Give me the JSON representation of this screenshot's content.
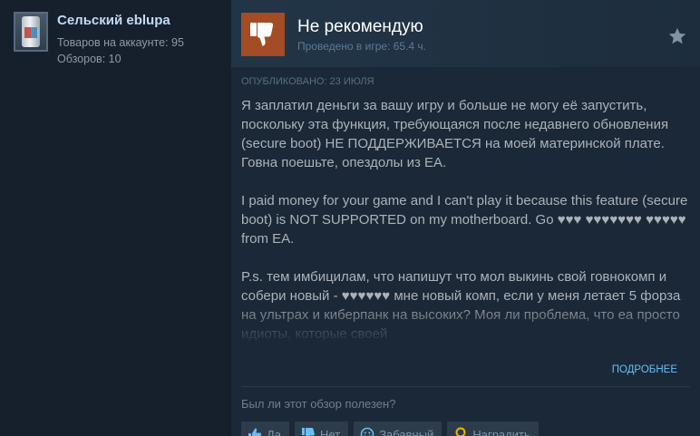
{
  "author": {
    "name": "Сельский eblupa",
    "games_owned": "Товаров на аккаунте: 95",
    "reviews": "Обзоров: 10"
  },
  "review": {
    "verdict": "Не рекомендую",
    "playtime": "Проведено в игре: 65.4 ч.",
    "posted": "Опубликовано: 23 июля",
    "paragraphs": [
      "Я заплатил деньги за вашу игру и больше не могу её запустить, поскольку эта функция, требующаяся после недавнего обновления (secure boot) НЕ ПОДДЕРЖИВАЕТСЯ на моей материнской плате. Говна поешьте, опездолы из EA.",
      "I paid money for your game and I can't play it because this feature (secure boot) is NOT SUPPORTED on my motherboard. Go ♥♥♥ ♥♥♥♥♥♥♥ ♥♥♥♥♥ from EA.",
      "P.s. тем имбицилам, что напишут что мол выкинь свой говнокомп и собери новый - ♥♥♥♥♥♥ мне новый комп, если у меня летает 5 форза на ультрах и киберпанк на высоких? Моя ли проблема, что еа просто идиоты, которые своей"
    ],
    "read_more": "Подробнее"
  },
  "helpful": {
    "question": "Был ли этот обзор полезен?",
    "yes": "Да",
    "no": "Нет",
    "funny": "Забавный",
    "award": "Наградить"
  },
  "icons": {
    "verdict": "thumbs-down-icon",
    "award": "star-icon",
    "yes": "thumbs-up-icon",
    "no": "thumbs-down-icon",
    "funny": "smiley-icon",
    "award_button": "award-icon"
  },
  "colors": {
    "background": "#1b2838",
    "verdict_box": "#a34c25",
    "link": "#66c0f4",
    "text": "#acb2b8"
  }
}
